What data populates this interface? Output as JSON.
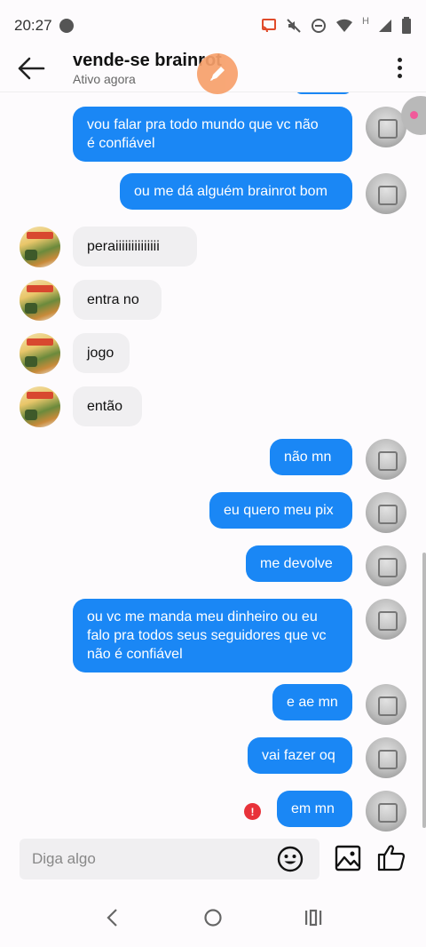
{
  "status_bar": {
    "time": "20:27",
    "icons": [
      "cast-icon",
      "mute-icon",
      "do-not-disturb-icon",
      "wifi-icon",
      "signal-h-icon",
      "signal-icon",
      "battery-icon"
    ],
    "network_type": "H"
  },
  "header": {
    "title": "vende-se brainrot",
    "subtitle": "Ativo agora"
  },
  "messages": [
    {
      "side": "out",
      "text": "vou falar pra todo mundo que vc não\né confiável"
    },
    {
      "side": "out",
      "text": "ou me dá alguém brainrot bom"
    },
    {
      "side": "in",
      "text": "peraiiiiiiiiiiiiii"
    },
    {
      "side": "in",
      "text": "entra no"
    },
    {
      "side": "in",
      "text": "jogo"
    },
    {
      "side": "in",
      "text": "então"
    },
    {
      "side": "out",
      "text": "não mn"
    },
    {
      "side": "out",
      "text": "eu quero meu pix"
    },
    {
      "side": "out",
      "text": "me devolve"
    },
    {
      "side": "out",
      "text": "ou vc me manda meu dinheiro ou eu\nfalo pra todos seus seguidores que vc\nnão é confiável"
    },
    {
      "side": "out",
      "text": "e ae mn"
    },
    {
      "side": "out",
      "text": "vai fazer oq"
    },
    {
      "side": "out",
      "text": "em mn",
      "failed": true
    }
  ],
  "alert_glyph": "!",
  "composer": {
    "placeholder": "Diga algo"
  },
  "colors": {
    "outgoing_bubble": "#1a87f5",
    "incoming_bubble": "#f0eff1",
    "error_badge": "#e8323a"
  }
}
